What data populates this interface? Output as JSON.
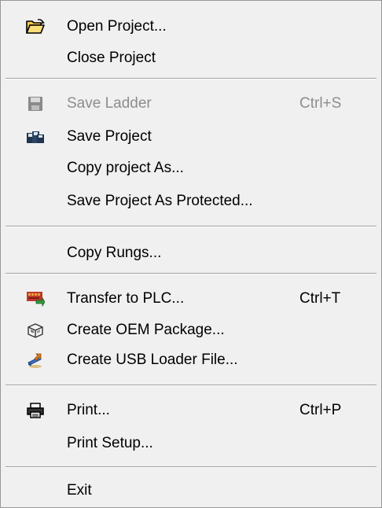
{
  "menu": {
    "items": {
      "open_project": {
        "label": "Open Project...",
        "icon": "open-folder-icon"
      },
      "close_project": {
        "label": "Close Project"
      },
      "save_ladder": {
        "label": "Save Ladder",
        "shortcut": "Ctrl+S",
        "icon": "floppy-disk-icon",
        "enabled": false
      },
      "save_project": {
        "label": "Save Project",
        "icon": "save-multiple-icon"
      },
      "copy_project_as": {
        "label": "Copy project As..."
      },
      "save_project_protected": {
        "label": "Save Project As Protected..."
      },
      "copy_rungs": {
        "label": "Copy Rungs..."
      },
      "transfer_plc": {
        "label": "Transfer to PLC...",
        "shortcut": "Ctrl+T",
        "icon": "plc-transfer-icon"
      },
      "create_oem": {
        "label": "Create OEM Package...",
        "icon": "package-icon"
      },
      "create_usb": {
        "label": "Create USB Loader File...",
        "icon": "usb-loader-icon"
      },
      "print": {
        "label": "Print...",
        "shortcut": "Ctrl+P",
        "icon": "printer-icon"
      },
      "print_setup": {
        "label": "Print Setup..."
      },
      "exit": {
        "label": "Exit"
      }
    }
  }
}
